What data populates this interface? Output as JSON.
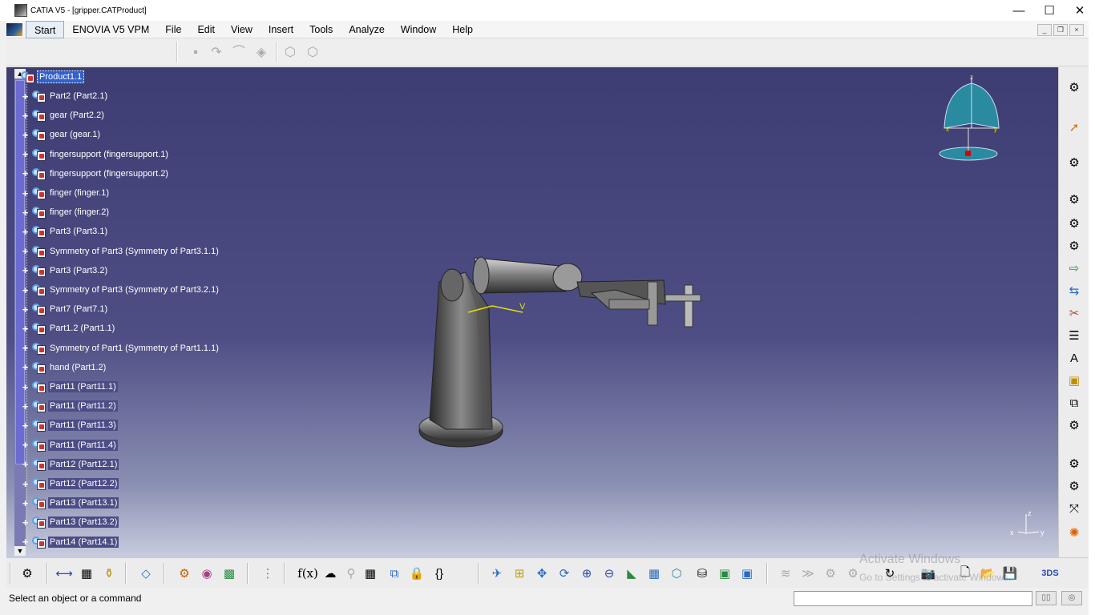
{
  "window": {
    "title": "CATIA V5 - [gripper.CATProduct]",
    "minimize": "—",
    "maximize": "☐",
    "close": "✕"
  },
  "menu": {
    "items": [
      "Start",
      "ENOVIA V5 VPM",
      "File",
      "Edit",
      "View",
      "Insert",
      "Tools",
      "Analyze",
      "Window",
      "Help"
    ]
  },
  "mdi": {
    "minimize": "_",
    "restore": "❐",
    "close": "×"
  },
  "tree": {
    "root": "Product1.1",
    "children": [
      "Part2 (Part2.1)",
      "gear (Part2.2)",
      "gear (gear.1)",
      "fingersupport (fingersupport.1)",
      "fingersupport (fingersupport.2)",
      "finger (finger.1)",
      "finger (finger.2)",
      "Part3 (Part3.1)",
      "Symmetry of Part3 (Symmetry of Part3.1.1)",
      "Part3 (Part3.2)",
      "Symmetry of Part3 (Symmetry of Part3.2.1)",
      "Part7 (Part7.1)",
      "Part1.2 (Part1.1)",
      "Symmetry of Part1 (Symmetry of Part1.1.1)",
      "hand (Part1.2)",
      "Part11 (Part11.1)",
      "Part11 (Part11.2)",
      "Part11 (Part11.3)",
      "Part11 (Part11.4)",
      "Part12 (Part12.1)",
      "Part12 (Part12.2)",
      "Part13 (Part13.1)",
      "Part13 (Part13.2)",
      "Part14 (Part14.1)"
    ]
  },
  "viewport": {
    "compass_z": "z",
    "compass_x": "x",
    "compass_y": "y",
    "triad_z": "z",
    "triad_x": "x",
    "triad_y": "y",
    "model_label": "V"
  },
  "watermark": {
    "line1": "Activate Windows",
    "line2": "Go to Settings to activate Windows."
  },
  "status": {
    "message": "Select an object or a command"
  },
  "colors": {
    "viewport_top": "#3d3d73",
    "viewport_bottom": "#c8ccde",
    "selection": "#3161c9",
    "compass": "#2a8aa0"
  }
}
